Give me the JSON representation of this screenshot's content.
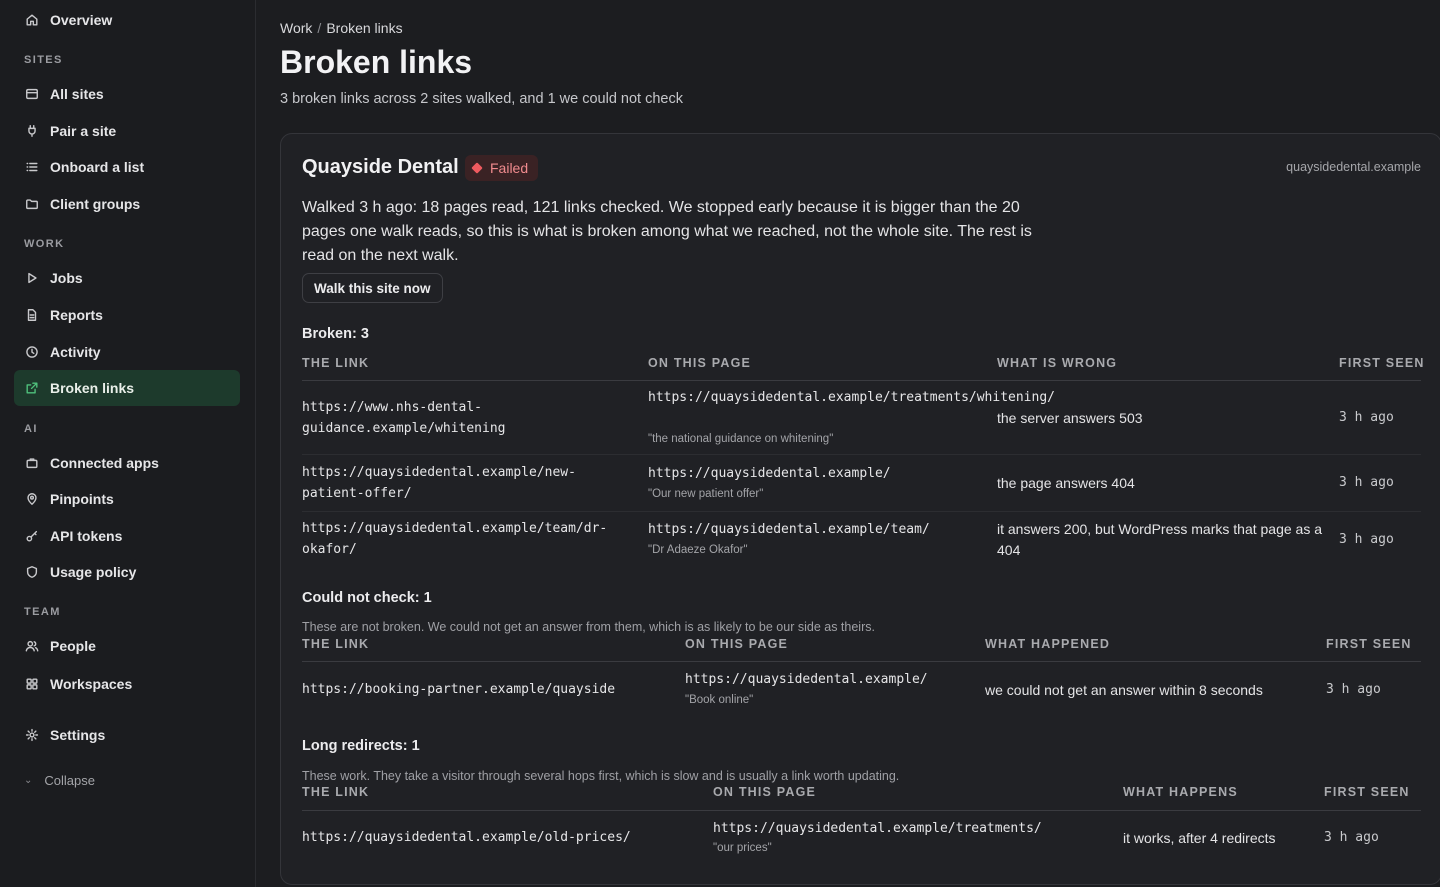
{
  "sidebar": {
    "overview": "Overview",
    "sections": {
      "sites": "SITES",
      "work": "WORK",
      "ai": "AI",
      "team": "TEAM"
    },
    "items": {
      "all_sites": "All sites",
      "pair_site": "Pair a site",
      "onboard_list": "Onboard a list",
      "client_groups": "Client groups",
      "jobs": "Jobs",
      "reports": "Reports",
      "activity": "Activity",
      "broken_links": "Broken links",
      "connected_apps": "Connected apps",
      "pinpoints": "Pinpoints",
      "api_tokens": "API tokens",
      "usage_policy": "Usage policy",
      "people": "People",
      "workspaces": "Workspaces",
      "settings": "Settings"
    },
    "collapse": "Collapse",
    "active_item": "broken_links",
    "accent": "#4fc07c"
  },
  "breadcrumb": {
    "parent": "Work",
    "separator": "/",
    "current": "Broken links"
  },
  "page": {
    "title": "Broken links",
    "subtitle": "3 broken links across 2 sites walked, and 1 we could not check"
  },
  "site": {
    "name": "Quayside Dental",
    "status": "Failed",
    "status_color": "#ef5a5f",
    "domain": "quaysidedental.example",
    "summary": "Walked 3 h ago: 18 pages read, 121 links checked. We stopped early because it is bigger than the 20 pages one walk reads, so this is what is broken among what we reached, not the whole site. The rest is read on the next walk.",
    "walk_button": "Walk this site now"
  },
  "broken": {
    "heading": "Broken: 3",
    "columns": [
      "THE LINK",
      "ON THIS PAGE",
      "WHAT IS WRONG",
      "FIRST SEEN"
    ],
    "rows": [
      {
        "link": "https://www.nhs-dental-guidance.example/whitening",
        "page": "https://quaysidedental.example/treatments/whitening/",
        "anchor": "\"the national guidance on whitening\"",
        "problem": "the server answers 503",
        "seen": "3 h ago"
      },
      {
        "link": "https://quaysidedental.example/new-patient-offer/",
        "page": "https://quaysidedental.example/",
        "anchor": "\"Our new patient offer\"",
        "problem": "the page answers 404",
        "seen": "3 h ago"
      },
      {
        "link": "https://quaysidedental.example/team/dr-okafor/",
        "page": "https://quaysidedental.example/team/",
        "anchor": "\"Dr Adaeze Okafor\"",
        "problem": "it answers 200, but WordPress marks that page as a 404",
        "seen": "3 h ago"
      }
    ]
  },
  "unchecked": {
    "heading": "Could not check: 1",
    "note": "These are not broken. We could not get an answer from them, which is as likely to be our side as theirs.",
    "columns": [
      "THE LINK",
      "ON THIS PAGE",
      "WHAT HAPPENED",
      "FIRST SEEN"
    ],
    "rows": [
      {
        "link": "https://booking-partner.example/quayside",
        "page": "https://quaysidedental.example/",
        "anchor": "\"Book online\"",
        "problem": "we could not get an answer within 8 seconds",
        "seen": "3 h ago"
      }
    ]
  },
  "redirects": {
    "heading": "Long redirects: 1",
    "note": "These work. They take a visitor through several hops first, which is slow and is usually a link worth updating.",
    "columns": [
      "THE LINK",
      "ON THIS PAGE",
      "WHAT HAPPENS",
      "FIRST SEEN"
    ],
    "rows": [
      {
        "link": "https://quaysidedental.example/old-prices/",
        "page": "https://quaysidedental.example/treatments/",
        "anchor": "\"our prices\"",
        "problem": "it works, after 4 redirects",
        "seen": "3 h ago"
      }
    ]
  }
}
